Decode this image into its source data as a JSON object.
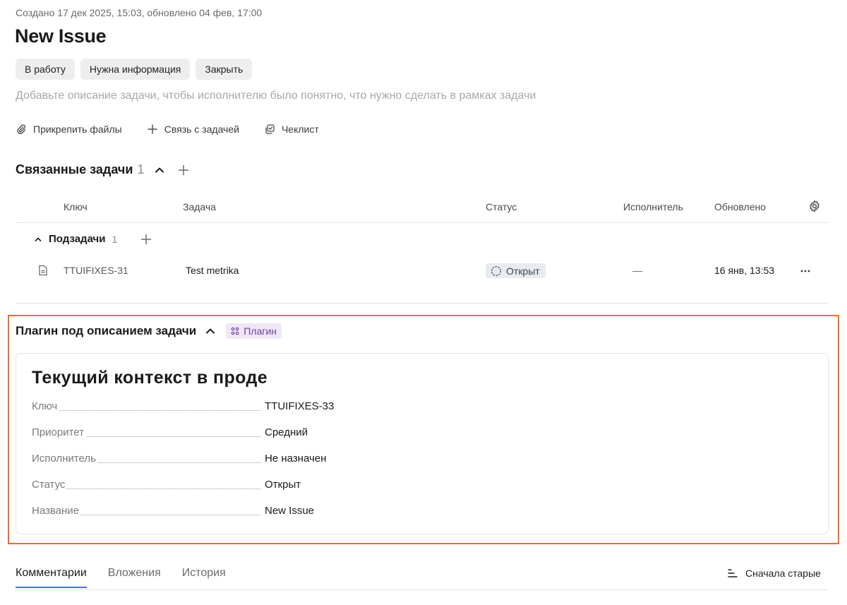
{
  "issue": {
    "meta": "Создано 17 дек 2025, 15:03, обновлено 04 фев, 17:00",
    "title": "New Issue",
    "actions": [
      "В работу",
      "Нужна информация",
      "Закрыть"
    ],
    "description_placeholder": "Добавьте описание задачи, чтобы исполнителю было понятно, что нужно сделать в рамках задачи",
    "tools": {
      "attach": "Прикрепить файлы",
      "link": "Связь с задачей",
      "checklist": "Чеклист"
    }
  },
  "related": {
    "title": "Связанные задачи",
    "count": "1",
    "columns": {
      "key": "Ключ",
      "task": "Задача",
      "status": "Статус",
      "assignee": "Исполнитель",
      "updated": "Обновлено"
    },
    "group": {
      "title": "Подзадачи",
      "count": "1"
    },
    "rows": [
      {
        "key": "TTUIFIXES-31",
        "task": "Test metrika",
        "status": "Открыт",
        "assignee": "—",
        "updated": "16 янв, 13:53"
      }
    ]
  },
  "plugin": {
    "title": "Плагин под описанием задачи",
    "badge": "Плагин",
    "card_title": "Текущий контекст в проде",
    "fields": [
      {
        "label": "Ключ",
        "value": "TTUIFIXES-33"
      },
      {
        "label": "Приоритет",
        "value": "Средний"
      },
      {
        "label": "Исполнитель",
        "value": "Не назначен"
      },
      {
        "label": "Статус",
        "value": "Открыт"
      },
      {
        "label": "Название",
        "value": "New Issue"
      }
    ],
    "highlight_color": "#f26b2f"
  },
  "tabs": {
    "items": [
      "Комментарии",
      "Вложения",
      "История"
    ],
    "active": "Комментарии",
    "sort_label": "Сначала старые"
  }
}
